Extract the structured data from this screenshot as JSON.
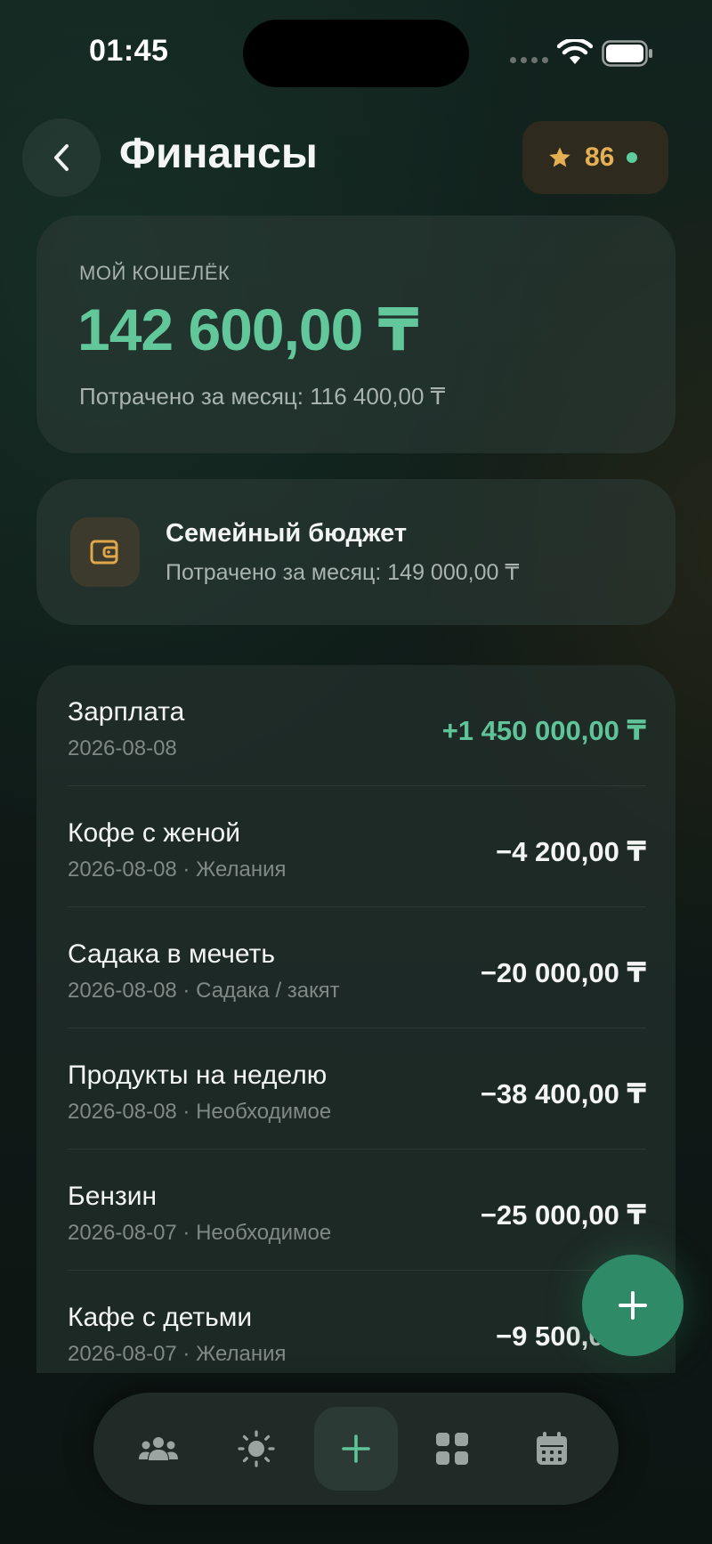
{
  "status_bar": {
    "time": "01:45"
  },
  "header": {
    "title": "Финансы",
    "points": "86"
  },
  "wallet": {
    "label": "МОЙ КОШЕЛЁК",
    "balance": "142 600,00 ₸",
    "spent": "Потрачено за месяц: 116 400,00 ₸"
  },
  "budget": {
    "title": "Семейный бюджет",
    "spent": "Потрачено за месяц: 149 000,00 ₸"
  },
  "transactions": [
    {
      "name": "Зарплата",
      "meta": "2026-08-08",
      "amount": "+1 450 000,00 ₸",
      "type": "income"
    },
    {
      "name": "Кофе с женой",
      "meta": "2026-08-08 · Желания",
      "amount": "−4 200,00 ₸",
      "type": "expense"
    },
    {
      "name": "Садака в мечеть",
      "meta": "2026-08-08 · Садака / закят",
      "amount": "−20 000,00 ₸",
      "type": "expense"
    },
    {
      "name": "Продукты на неделю",
      "meta": "2026-08-08 · Необходимое",
      "amount": "−38 400,00 ₸",
      "type": "expense"
    },
    {
      "name": "Бензин",
      "meta": "2026-08-07 · Необходимое",
      "amount": "−25 000,00 ₸",
      "type": "expense"
    },
    {
      "name": "Кафе с детьми",
      "meta": "2026-08-07 · Желания",
      "amount": "−9 500,00 ₸",
      "type": "expense"
    }
  ],
  "nav": {
    "items": [
      "family-icon",
      "sun-icon",
      "plus-icon",
      "grid-icon",
      "calendar-icon"
    ],
    "active_index": 2
  },
  "colors": {
    "accent_green": "#5fc499",
    "points_gold": "#e5b055",
    "card_bg": "#2c3a36"
  }
}
